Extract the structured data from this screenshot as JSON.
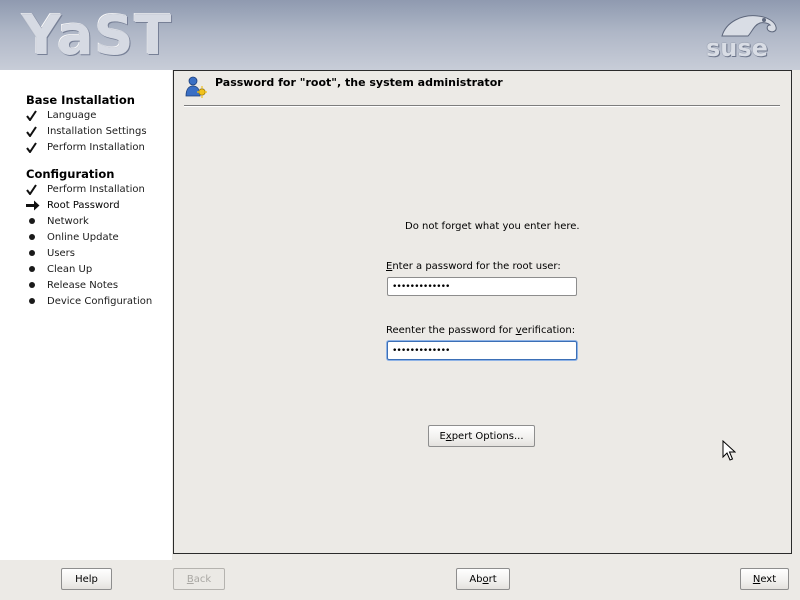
{
  "header": {
    "logo_text": "YaST",
    "brand_text": "suse",
    "brand_icon": "gecko-icon"
  },
  "sidebar": {
    "sections": [
      {
        "heading": "Base Installation",
        "items": [
          {
            "label": "Language",
            "status": "done"
          },
          {
            "label": "Installation Settings",
            "status": "done"
          },
          {
            "label": "Perform Installation",
            "status": "done"
          }
        ]
      },
      {
        "heading": "Configuration",
        "items": [
          {
            "label": "Perform Installation",
            "status": "done"
          },
          {
            "label": "Root Password",
            "status": "current"
          },
          {
            "label": "Network",
            "status": "pending"
          },
          {
            "label": "Online Update",
            "status": "pending"
          },
          {
            "label": "Users",
            "status": "pending"
          },
          {
            "label": "Clean Up",
            "status": "pending"
          },
          {
            "label": "Release Notes",
            "status": "pending"
          },
          {
            "label": "Device Configuration",
            "status": "pending"
          }
        ]
      }
    ]
  },
  "main": {
    "title": "Password for \"root\", the system administrator",
    "title_icon": "user-key-icon",
    "hint": "Do not forget what you enter here.",
    "password_field": {
      "label_pre": "",
      "label_mnemonic": "E",
      "label_post": "nter a password for the root user:",
      "value": "•••••••••••••"
    },
    "verify_field": {
      "label_pre": "Reenter the password for ",
      "label_mnemonic": "v",
      "label_post": "erification:",
      "value": "•••••••••••••"
    },
    "expert_button": {
      "pre": "E",
      "mnemonic": "x",
      "post": "pert Options..."
    }
  },
  "footer": {
    "help": "Help",
    "back": {
      "pre": "",
      "mnemonic": "B",
      "post": "ack"
    },
    "abort": {
      "pre": "Ab",
      "mnemonic": "o",
      "post": "rt"
    },
    "next": {
      "pre": "",
      "mnemonic": "N",
      "post": "ext"
    }
  }
}
